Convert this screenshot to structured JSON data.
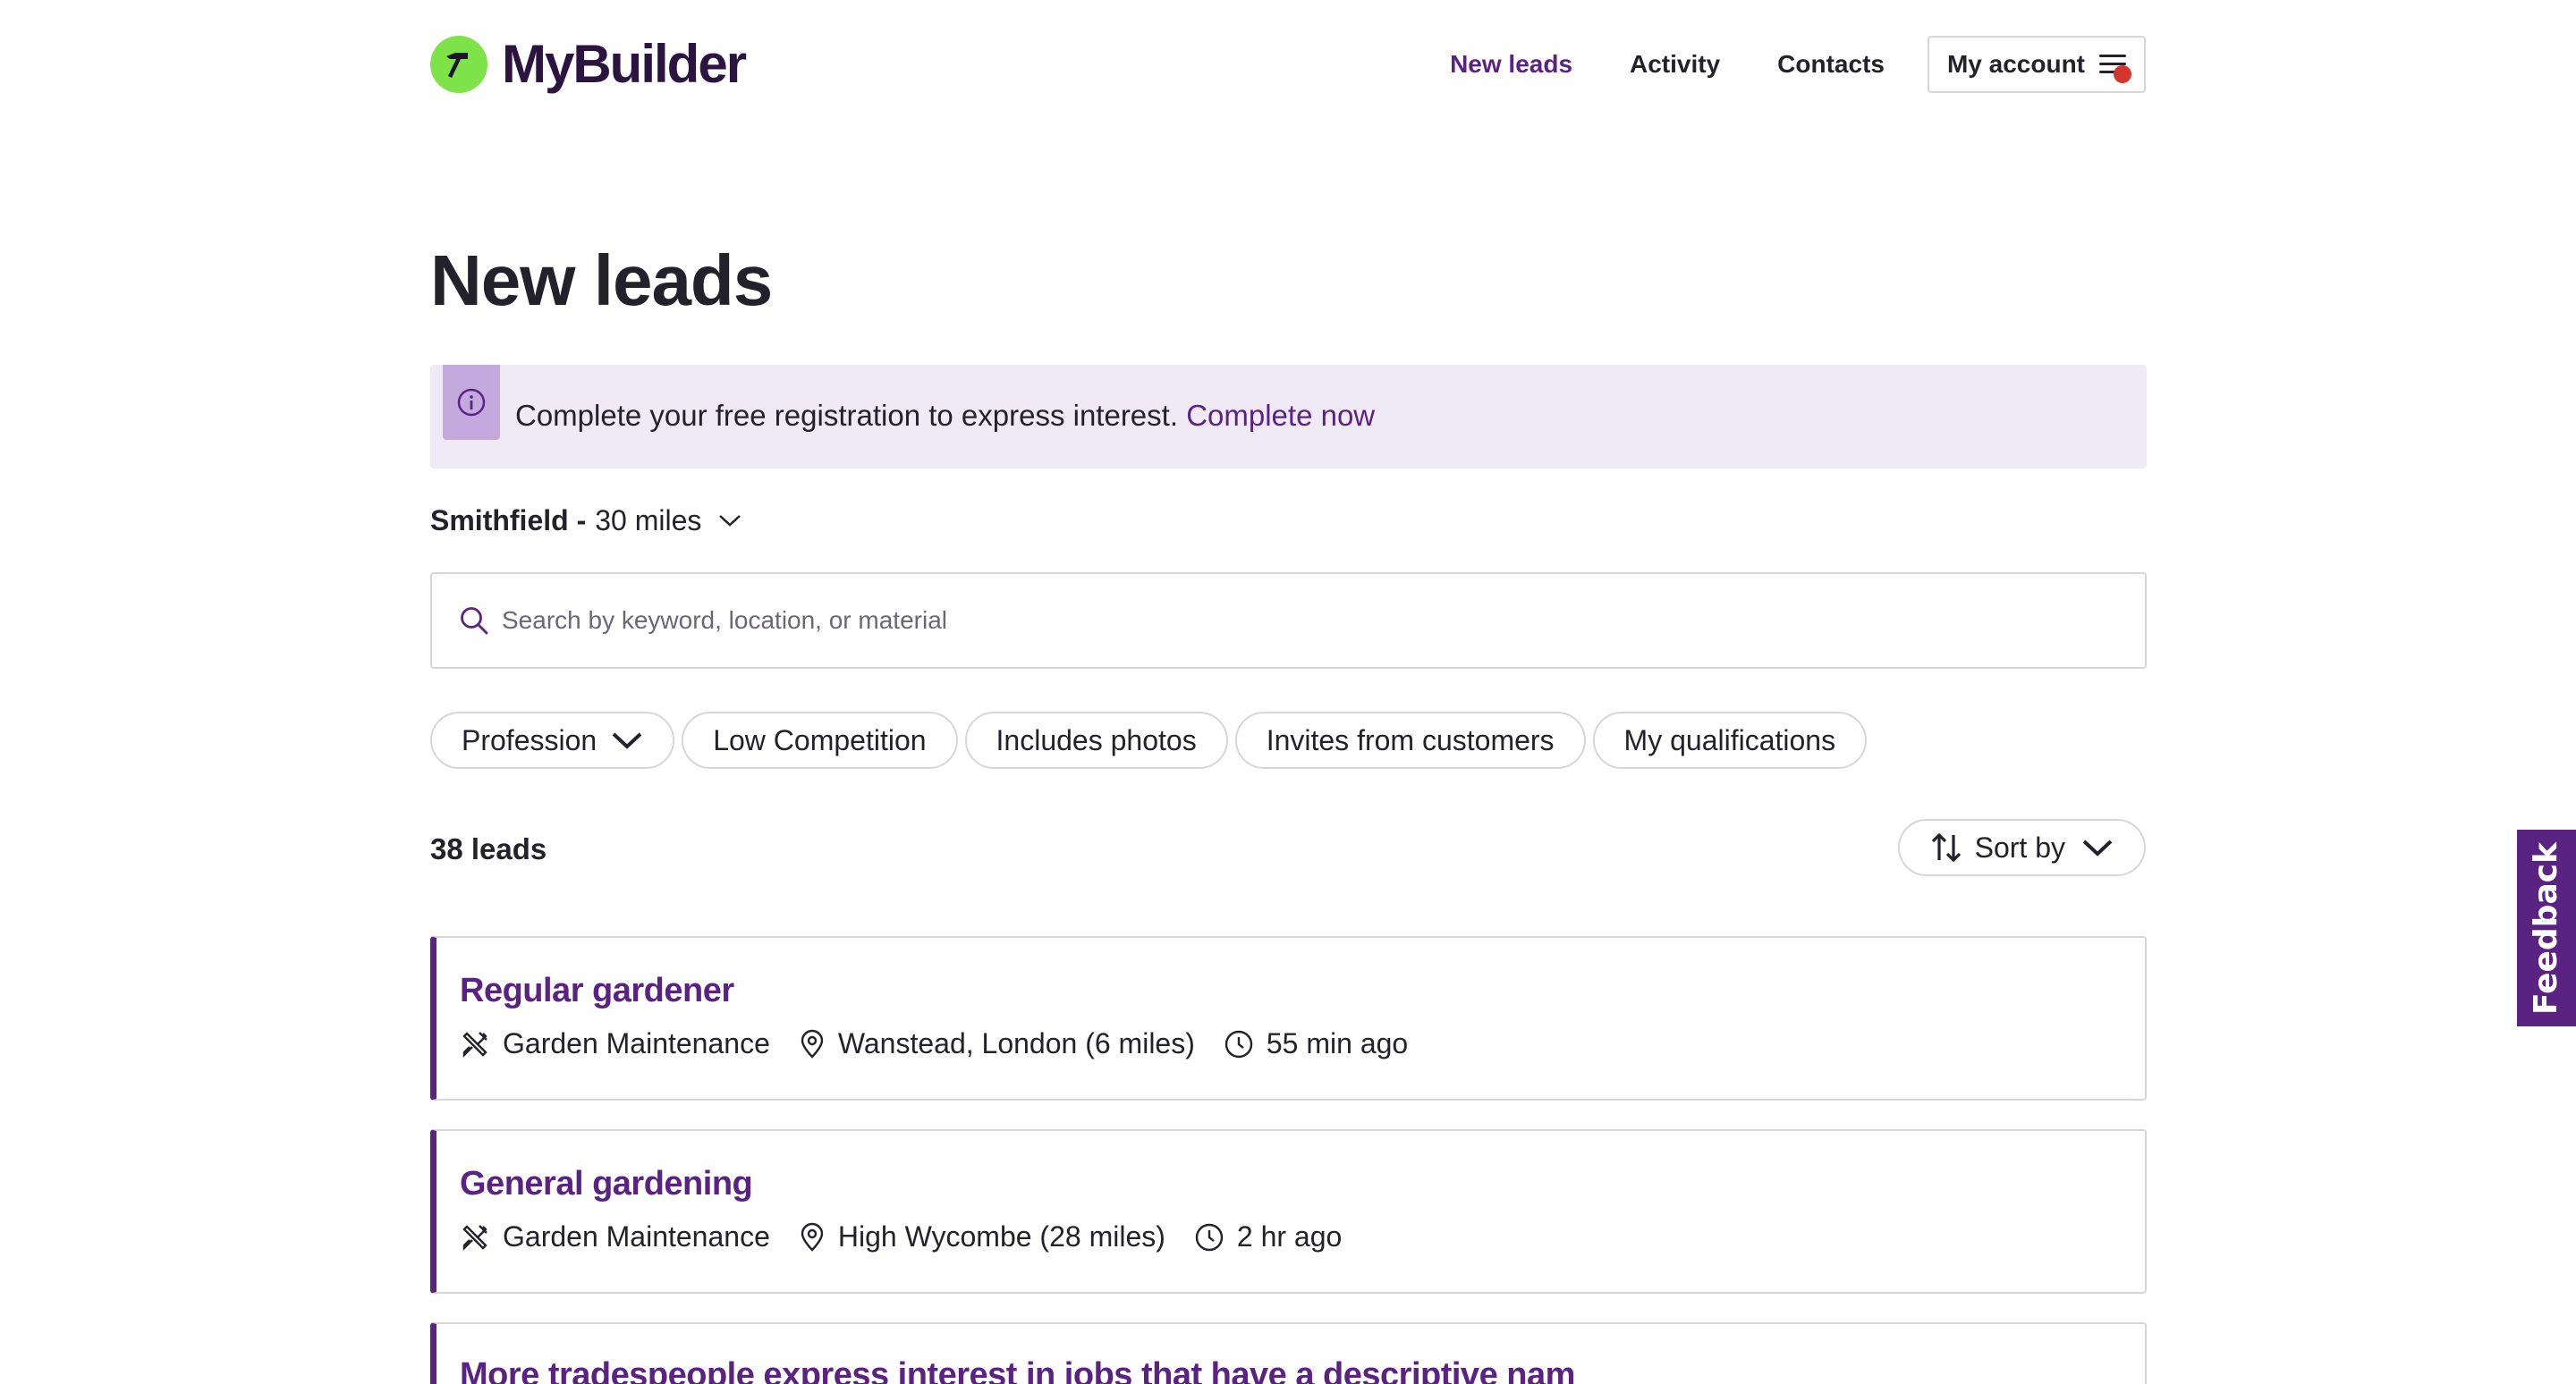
{
  "brand": {
    "name": "MyBuilder",
    "logo_color": "#7de349",
    "text_color": "#2b1540"
  },
  "nav": {
    "items": [
      {
        "label": "New leads",
        "active": true
      },
      {
        "label": "Activity",
        "active": false
      },
      {
        "label": "Contacts",
        "active": false
      }
    ],
    "account_label": "My account",
    "notification_dot_color": "#d4352d"
  },
  "page": {
    "title": "New leads"
  },
  "banner": {
    "text": "Complete your free registration to express interest.",
    "link": "Complete now",
    "icon": "info-icon"
  },
  "location": {
    "place": "Smithfield -",
    "radius": "30 miles"
  },
  "search": {
    "placeholder": "Search by keyword, location, or material",
    "value": ""
  },
  "filters": {
    "profession": "Profession",
    "chips": [
      "Low Competition",
      "Includes photos",
      "Invites from customers",
      "My qualifications"
    ]
  },
  "results": {
    "count_label": "38 leads",
    "sort_label": "Sort by"
  },
  "leads": [
    {
      "title": "Regular gardener",
      "category": "Garden Maintenance",
      "location": "Wanstead, London (6 miles)",
      "time": "55 min ago"
    },
    {
      "title": "General gardening",
      "category": "Garden Maintenance",
      "location": "High Wycombe (28 miles)",
      "time": "2 hr ago"
    },
    {
      "title": "More tradespeople express interest in jobs that have a descriptive nam",
      "category": "",
      "location": "",
      "time": ""
    }
  ],
  "feedback": {
    "label": "Feedback"
  },
  "colors": {
    "accent": "#5b2381",
    "banner_bg": "#efeaf5",
    "border": "#d8d6dd"
  }
}
